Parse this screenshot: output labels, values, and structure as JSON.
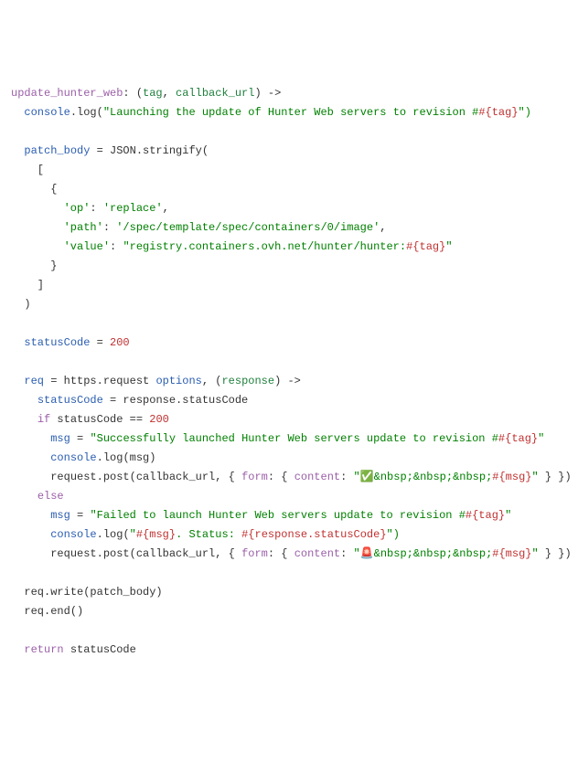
{
  "line1": {
    "func_name": "update_hunter_web",
    "colon": ": (",
    "param1": "tag",
    "comma": ", ",
    "param2": "callback_url",
    "arrow": ") ->"
  },
  "line2": {
    "obj": "console",
    "dot_method": ".log(",
    "str": "\"Launching the update of Hunter Web servers to revision #",
    "interp": "#{tag}",
    "close": "\")"
  },
  "line4_var": "patch_body",
  "line4_assign": " = JSON.stringify(",
  "line5_open": "    [",
  "line6_brace": "      {",
  "line7_key": "'op'",
  "line7_colon": ": ",
  "line7_val": "'replace'",
  "line7_comma": ",",
  "line8_key": "'path'",
  "line8_colon": ": ",
  "line8_val": "'/spec/template/spec/containers/0/image'",
  "line8_comma": ",",
  "line9_key": "'value'",
  "line9_colon": ": ",
  "line9_open": "\"registry.containers.ovh.net/hunter/hunter:",
  "line9_interp": "#{tag}",
  "line9_close": "\"",
  "line10_brace": "      }",
  "line11_close": "    ]",
  "line12_paren": "  )",
  "line14_var": "statusCode",
  "line14_assign": " = ",
  "line14_val": "200",
  "line16_var": "req",
  "line16_assign": " = https.request ",
  "line16_opts": "options",
  "line16_comma": ", (",
  "line16_param": "response",
  "line16_arrow": ") ->",
  "line17_var": "statusCode",
  "line17_assign": " = response.statusCode",
  "line18_if": "if",
  "line18_var": " statusCode == ",
  "line18_val": "200",
  "line19_var": "msg",
  "line19_assign": " = ",
  "line19_str": "\"Successfully launched Hunter Web servers update to revision #",
  "line19_interp": "#{tag}",
  "line19_close": "\"",
  "line20_console": "console",
  "line20_log": ".log(msg)",
  "line21_req": "request.post(callback_url, { ",
  "line21_form": "form",
  "line21_colon1": ": { ",
  "line21_content": "content",
  "line21_colon2": ": ",
  "line21_str_open": "\"✅&nbsp;&nbsp;&nbsp;",
  "line21_interp": "#{msg}",
  "line21_str_close": "\"",
  "line21_close": " } })",
  "line22_else": "else",
  "line23_var": "msg",
  "line23_assign": " = ",
  "line23_str": "\"Failed to launch Hunter Web servers update to revision #",
  "line23_interp": "#{tag}",
  "line23_close": "\"",
  "line24_console": "console",
  "line24_log": ".log(",
  "line24_str_open": "\"",
  "line24_interp1": "#{msg}",
  "line24_mid": ". Status: ",
  "line24_interp2": "#{response.statusCode}",
  "line24_str_close": "\")",
  "line25_req": "request.post(callback_url, { ",
  "line25_form": "form",
  "line25_colon1": ": { ",
  "line25_content": "content",
  "line25_colon2": ": ",
  "line25_str_open": "\"🚨&nbsp;&nbsp;&nbsp;",
  "line25_interp": "#{msg}",
  "line25_str_close": "\"",
  "line25_close": " } })",
  "line27_req": "req.write(patch_body)",
  "line28_req": "req.end()",
  "line30_return": "return",
  "line30_var": " statusCode"
}
